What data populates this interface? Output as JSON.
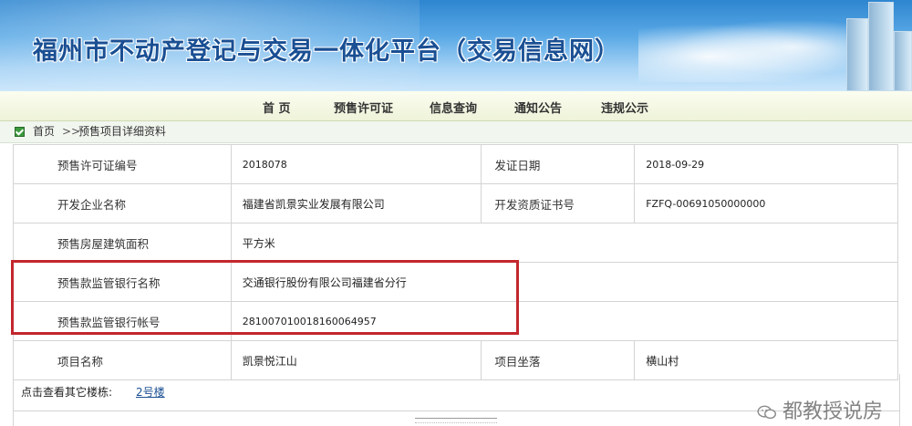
{
  "header": {
    "title": "福州市不动产登记与交易一体化平台（交易信息网）"
  },
  "nav": {
    "items": [
      "首 页",
      "预售许可证",
      "信息查询",
      "通知公告",
      "违规公示"
    ]
  },
  "breadcrumb": {
    "home": "首页",
    "separator": ">>",
    "current": "预售项目详细资料"
  },
  "details": {
    "permit_no_label": "预售许可证编号",
    "permit_no": "2018078",
    "issue_date_label": "发证日期",
    "issue_date": "2018-09-29",
    "developer_label": "开发企业名称",
    "developer": "福建省凯景实业发展有限公司",
    "qualification_label": "开发资质证书号",
    "qualification": "FZFQ-00691050000000",
    "area_label": "预售房屋建筑面积",
    "area": "平方米",
    "bank_name_label": "预售款监管银行名称",
    "bank_name": "交通银行股份有限公司福建省分行",
    "bank_account_label": "预售款监管银行帐号",
    "bank_account": "281007010018160064957",
    "project_name_label": "项目名称",
    "project_name": "凯景悦江山",
    "project_location_label": "项目坐落",
    "project_location": "横山村"
  },
  "other_buildings": {
    "label": "点击查看其它楼栋:",
    "link": "2号楼"
  },
  "watermark": {
    "text": "都教授说房"
  },
  "colors": {
    "highlight": "#c2272d",
    "link": "#1a4f93",
    "banner_title": "#1a4f93"
  }
}
